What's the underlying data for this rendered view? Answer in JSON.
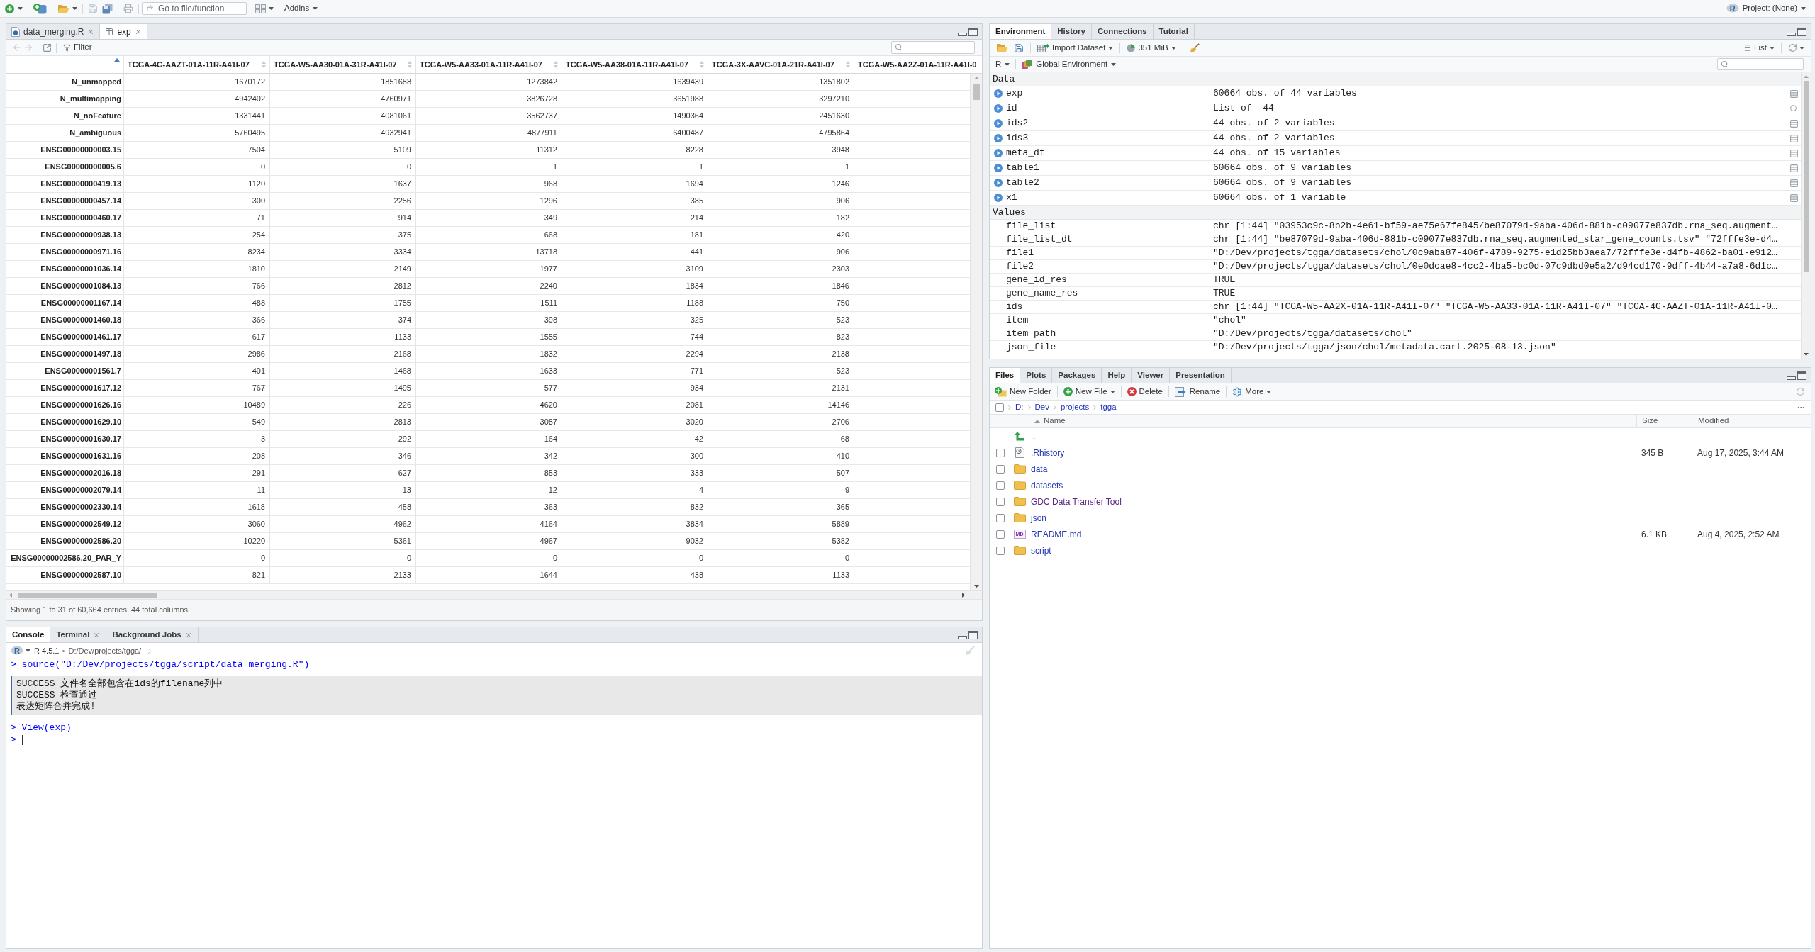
{
  "toolbar": {
    "goto_placeholder": "Go to file/function",
    "addins": "Addins",
    "project_logo": "R",
    "project": "Project: (None)"
  },
  "source_pane": {
    "tabs": [
      {
        "label": "data_merging.R",
        "kind": "script",
        "closable": true,
        "selected": false
      },
      {
        "label": "exp",
        "kind": "data",
        "closable": true,
        "selected": true
      }
    ],
    "filter": "Filter",
    "columns": [
      "TCGA-4G-AAZT-01A-11R-A41I-07",
      "TCGA-W5-AA30-01A-31R-A41I-07",
      "TCGA-W5-AA33-01A-11R-A41I-07",
      "TCGA-W5-AA38-01A-11R-A41I-07",
      "TCGA-3X-AAVC-01A-21R-A41I-07",
      "TCGA-W5-AA2Z-01A-11R-A41I-0"
    ],
    "rows": [
      {
        "name": "N_unmapped",
        "values": [
          "1670172",
          "1851688",
          "1273842",
          "1639439",
          "1351802"
        ]
      },
      {
        "name": "N_multimapping",
        "values": [
          "4942402",
          "4760971",
          "3826728",
          "3651988",
          "3297210"
        ]
      },
      {
        "name": "N_noFeature",
        "values": [
          "1331441",
          "4081061",
          "3562737",
          "1490364",
          "2451630"
        ]
      },
      {
        "name": "N_ambiguous",
        "values": [
          "5760495",
          "4932941",
          "4877911",
          "6400487",
          "4795864"
        ]
      },
      {
        "name": "ENSG00000000003.15",
        "values": [
          "7504",
          "5109",
          "11312",
          "8228",
          "3948"
        ]
      },
      {
        "name": "ENSG00000000005.6",
        "values": [
          "0",
          "0",
          "1",
          "1",
          "1"
        ]
      },
      {
        "name": "ENSG00000000419.13",
        "values": [
          "1120",
          "1637",
          "968",
          "1694",
          "1246"
        ]
      },
      {
        "name": "ENSG00000000457.14",
        "values": [
          "300",
          "2256",
          "1296",
          "385",
          "906"
        ]
      },
      {
        "name": "ENSG00000000460.17",
        "values": [
          "71",
          "914",
          "349",
          "214",
          "182"
        ]
      },
      {
        "name": "ENSG00000000938.13",
        "values": [
          "254",
          "375",
          "668",
          "181",
          "420"
        ]
      },
      {
        "name": "ENSG00000000971.16",
        "values": [
          "8234",
          "3334",
          "13718",
          "441",
          "906"
        ]
      },
      {
        "name": "ENSG00000001036.14",
        "values": [
          "1810",
          "2149",
          "1977",
          "3109",
          "2303"
        ]
      },
      {
        "name": "ENSG00000001084.13",
        "values": [
          "766",
          "2812",
          "2240",
          "1834",
          "1846"
        ]
      },
      {
        "name": "ENSG00000001167.14",
        "values": [
          "488",
          "1755",
          "1511",
          "1188",
          "750"
        ]
      },
      {
        "name": "ENSG00000001460.18",
        "values": [
          "366",
          "374",
          "398",
          "325",
          "523"
        ]
      },
      {
        "name": "ENSG00000001461.17",
        "values": [
          "617",
          "1133",
          "1555",
          "744",
          "823"
        ]
      },
      {
        "name": "ENSG00000001497.18",
        "values": [
          "2986",
          "2168",
          "1832",
          "2294",
          "2138"
        ]
      },
      {
        "name": "ENSG00000001561.7",
        "values": [
          "401",
          "1468",
          "1633",
          "771",
          "523"
        ]
      },
      {
        "name": "ENSG00000001617.12",
        "values": [
          "767",
          "1495",
          "577",
          "934",
          "2131"
        ]
      },
      {
        "name": "ENSG00000001626.16",
        "values": [
          "10489",
          "226",
          "4620",
          "2081",
          "14146"
        ]
      },
      {
        "name": "ENSG00000001629.10",
        "values": [
          "549",
          "2813",
          "3087",
          "3020",
          "2706"
        ]
      },
      {
        "name": "ENSG00000001630.17",
        "values": [
          "3",
          "292",
          "164",
          "42",
          "68"
        ]
      },
      {
        "name": "ENSG00000001631.16",
        "values": [
          "208",
          "346",
          "342",
          "300",
          "410"
        ]
      },
      {
        "name": "ENSG00000002016.18",
        "values": [
          "291",
          "627",
          "853",
          "333",
          "507"
        ]
      },
      {
        "name": "ENSG00000002079.14",
        "values": [
          "11",
          "13",
          "12",
          "4",
          "9"
        ]
      },
      {
        "name": "ENSG00000002330.14",
        "values": [
          "1618",
          "458",
          "363",
          "832",
          "365"
        ]
      },
      {
        "name": "ENSG00000002549.12",
        "values": [
          "3060",
          "4962",
          "4164",
          "3834",
          "5889"
        ]
      },
      {
        "name": "ENSG00000002586.20",
        "values": [
          "10220",
          "5361",
          "4967",
          "9032",
          "5382"
        ]
      },
      {
        "name": "ENSG00000002586.20_PAR_Y",
        "values": [
          "0",
          "0",
          "0",
          "0",
          "0"
        ]
      },
      {
        "name": "ENSG00000002587.10",
        "values": [
          "821",
          "2133",
          "1644",
          "438",
          "1133"
        ]
      }
    ],
    "footer": "Showing 1 to 31 of 60,664 entries, 44 total columns"
  },
  "console_pane": {
    "tabs": [
      {
        "label": "Console",
        "closable": false,
        "selected": true
      },
      {
        "label": "Terminal",
        "closable": true,
        "selected": false
      },
      {
        "label": "Background Jobs",
        "closable": true,
        "selected": false
      }
    ],
    "logo": "R",
    "version": "R 4.5.1",
    "path": "D:/Dev/projects/tgga/",
    "lines": [
      {
        "kind": "input",
        "prompt": ">",
        "text": "source(\"D:/Dev/projects/tgga/script/data_merging.R\")"
      },
      {
        "kind": "message",
        "lines": [
          "SUCCESS 文件名全部包含在ids的filename列中",
          "SUCCESS 检查通过",
          "表达矩阵合并完成!"
        ]
      },
      {
        "kind": "input",
        "prompt": ">",
        "text": "View(exp)"
      },
      {
        "kind": "prompt",
        "prompt": ">"
      }
    ]
  },
  "environment_pane": {
    "tabs": [
      {
        "label": "Environment",
        "selected": true
      },
      {
        "label": "History",
        "selected": false
      },
      {
        "label": "Connections",
        "selected": false
      },
      {
        "label": "Tutorial",
        "selected": false
      }
    ],
    "import_dataset": "Import Dataset",
    "memory": "351 MiB",
    "view_mode": "List",
    "language": "R",
    "environment": "Global Environment",
    "sections": [
      {
        "title": "Data",
        "kind": "data",
        "rows": [
          {
            "name": "exp",
            "value": "60664 obs. of 44 variables",
            "kind": "data_frame"
          },
          {
            "name": "id",
            "value": "List of  44",
            "kind": "list"
          },
          {
            "name": "ids2",
            "value": "44 obs. of 2 variables",
            "kind": "data_frame"
          },
          {
            "name": "ids3",
            "value": "44 obs. of 2 variables",
            "kind": "data_frame"
          },
          {
            "name": "meta_dt",
            "value": "44 obs. of 15 variables",
            "kind": "data_frame"
          },
          {
            "name": "table1",
            "value": "60664 obs. of 9 variables",
            "kind": "data_frame"
          },
          {
            "name": "table2",
            "value": "60664 obs. of 9 variables",
            "kind": "data_frame"
          },
          {
            "name": "x1",
            "value": "60664 obs. of 1 variable",
            "kind": "data_frame"
          }
        ]
      },
      {
        "title": "Values",
        "kind": "values",
        "rows": [
          {
            "name": "file_list",
            "value": "chr [1:44] \"03953c9c-8b2b-4e61-bf59-ae75e67fe845/be87079d-9aba-406d-881b-c09077e837db.rna_seq.augment…"
          },
          {
            "name": "file_list_dt",
            "value": "chr [1:44] \"be87079d-9aba-406d-881b-c09077e837db.rna_seq.augmented_star_gene_counts.tsv\" \"72fffe3e-d4…"
          },
          {
            "name": "file1",
            "value": "\"D:/Dev/projects/tgga/datasets/chol/0c9aba87-406f-4789-9275-e1d25bb3aea7/72fffe3e-d4fb-4862-ba01-e912…"
          },
          {
            "name": "file2",
            "value": "\"D:/Dev/projects/tgga/datasets/chol/0e0dcae8-4cc2-4ba5-bc0d-07c9dbd0e5a2/d94cd170-9dff-4b44-a7a8-6d1c…"
          },
          {
            "name": "gene_id_res",
            "value": "TRUE"
          },
          {
            "name": "gene_name_res",
            "value": "TRUE"
          },
          {
            "name": "ids",
            "value": "chr [1:44] \"TCGA-W5-AA2X-01A-11R-A41I-07\" \"TCGA-W5-AA33-01A-11R-A41I-07\" \"TCGA-4G-AAZT-01A-11R-A41I-0…"
          },
          {
            "name": "item",
            "value": "\"chol\""
          },
          {
            "name": "item_path",
            "value": "\"D:/Dev/projects/tgga/datasets/chol\""
          },
          {
            "name": "json_file",
            "value": "\"D:/Dev/projects/tgga/json/chol/metadata.cart.2025-08-13.json\""
          }
        ]
      }
    ]
  },
  "files_pane": {
    "tabs": [
      {
        "label": "Files",
        "selected": true
      },
      {
        "label": "Plots",
        "selected": false
      },
      {
        "label": "Packages",
        "selected": false
      },
      {
        "label": "Help",
        "selected": false
      },
      {
        "label": "Viewer",
        "selected": false
      },
      {
        "label": "Presentation",
        "selected": false
      }
    ],
    "actions": [
      {
        "label": "New Folder",
        "kind": "new_folder",
        "dropdown": false
      },
      {
        "label": "New File",
        "kind": "new_file",
        "dropdown": true
      },
      {
        "label": "Delete",
        "kind": "delete",
        "dropdown": false
      },
      {
        "label": "Rename",
        "kind": "rename",
        "dropdown": false
      },
      {
        "label": "More",
        "kind": "more",
        "dropdown": true
      }
    ],
    "select_all_checked": false,
    "breadcrumb": [
      "D:",
      "Dev",
      "projects",
      "tgga"
    ],
    "columns": {
      "name": "Name",
      "size": "Size",
      "modified": "Modified"
    },
    "files": [
      {
        "name": "..",
        "kind": "parent",
        "visited": false
      },
      {
        "name": ".Rhistory",
        "kind": "history",
        "size": "345 B",
        "modified": "Aug 17, 2025, 3:44 AM",
        "checked": false,
        "visited": false
      },
      {
        "name": "data",
        "kind": "folder",
        "checked": false,
        "visited": false
      },
      {
        "name": "datasets",
        "kind": "folder",
        "checked": false,
        "visited": false
      },
      {
        "name": "GDC Data Transfer Tool",
        "kind": "folder",
        "checked": false,
        "visited": true
      },
      {
        "name": "json",
        "kind": "folder",
        "checked": false,
        "visited": false
      },
      {
        "name": "README.md",
        "kind": "markdown",
        "icon_label": "MD",
        "size": "6.1 KB",
        "modified": "Aug 4, 2025, 2:52 AM",
        "checked": false,
        "visited": false
      },
      {
        "name": "script",
        "kind": "folder",
        "checked": false,
        "visited": false
      }
    ]
  }
}
